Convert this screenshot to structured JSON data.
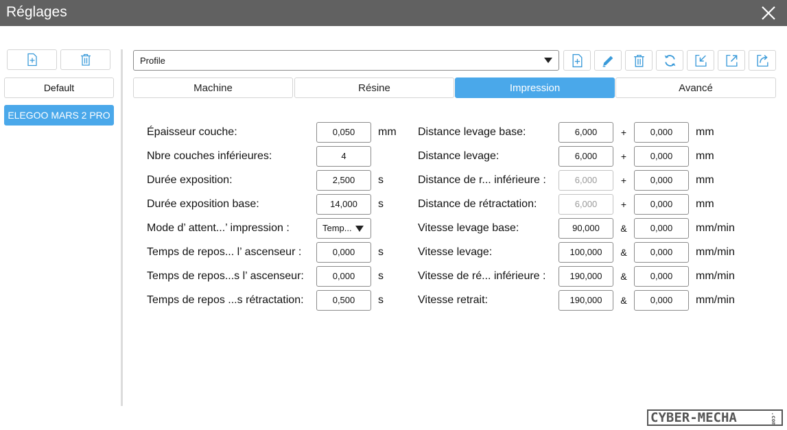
{
  "window": {
    "title": "Réglages"
  },
  "sidebar": {
    "profiles": [
      {
        "label": "Default",
        "active": false
      },
      {
        "label": "ELEGOO MARS 2 PRO",
        "active": true
      }
    ]
  },
  "toolbar": {
    "profile_select_value": "Profile",
    "icons": [
      "add-file-icon",
      "edit-icon",
      "trash-icon",
      "refresh-icon",
      "import-icon",
      "export-icon",
      "share-icon"
    ]
  },
  "tabs": [
    {
      "label": "Machine",
      "active": false
    },
    {
      "label": "Résine",
      "active": false
    },
    {
      "label": "Impression",
      "active": true
    },
    {
      "label": "Avancé",
      "active": false
    }
  ],
  "left_settings": [
    {
      "label": "Épaisseur couche:",
      "value": "0,050",
      "unit": "mm"
    },
    {
      "label": "Nbre couches inférieures:",
      "value": "4",
      "unit": ""
    },
    {
      "label": "Durée exposition:",
      "value": "2,500",
      "unit": "s"
    },
    {
      "label": "Durée exposition base:",
      "value": "14,000",
      "unit": "s"
    },
    {
      "label": "Mode d’ attent...’ impression :",
      "value": "Temp...",
      "unit": ""
    },
    {
      "label": "Temps de repos... l’ ascenseur :",
      "value": "0,000",
      "unit": "s"
    },
    {
      "label": "Temps de repos...s l’ ascenseur:",
      "value": "0,000",
      "unit": "s"
    },
    {
      "label": "Temps de repos ...s rétractation:",
      "value": "0,500",
      "unit": "s"
    }
  ],
  "right_settings": [
    {
      "label": "Distance levage base:",
      "value1": "6,000",
      "op": "+",
      "value2": "0,000",
      "unit": "mm"
    },
    {
      "label": "Distance levage:",
      "value1": "6,000",
      "op": "+",
      "value2": "0,000",
      "unit": "mm"
    },
    {
      "label": "Distance de r... inférieure :",
      "value1": "6,000",
      "op": "+",
      "value2": "0,000",
      "unit": "mm"
    },
    {
      "label": "Distance de rétractation:",
      "value1": "6,000",
      "op": "+",
      "value2": "0,000",
      "unit": "mm"
    },
    {
      "label": "Vitesse levage base:",
      "value1": "90,000",
      "op": "&",
      "value2": "0,000",
      "unit": "mm/min"
    },
    {
      "label": "Vitesse levage:",
      "value1": "100,000",
      "op": "&",
      "value2": "0,000",
      "unit": "mm/min"
    },
    {
      "label": "Vitesse de ré... inférieure :",
      "value1": "190,000",
      "op": "&",
      "value2": "0,000",
      "unit": "mm/min"
    },
    {
      "label": "Vitesse retrait:",
      "value1": "190,000",
      "op": "&",
      "value2": "0,000",
      "unit": "mm/min"
    }
  ],
  "watermark": {
    "text": "CYBER-MECHA",
    "suffix": ".com"
  },
  "colors": {
    "accent": "#4aa8ea",
    "titlebar": "#616161",
    "icon": "#3a9ad9"
  }
}
